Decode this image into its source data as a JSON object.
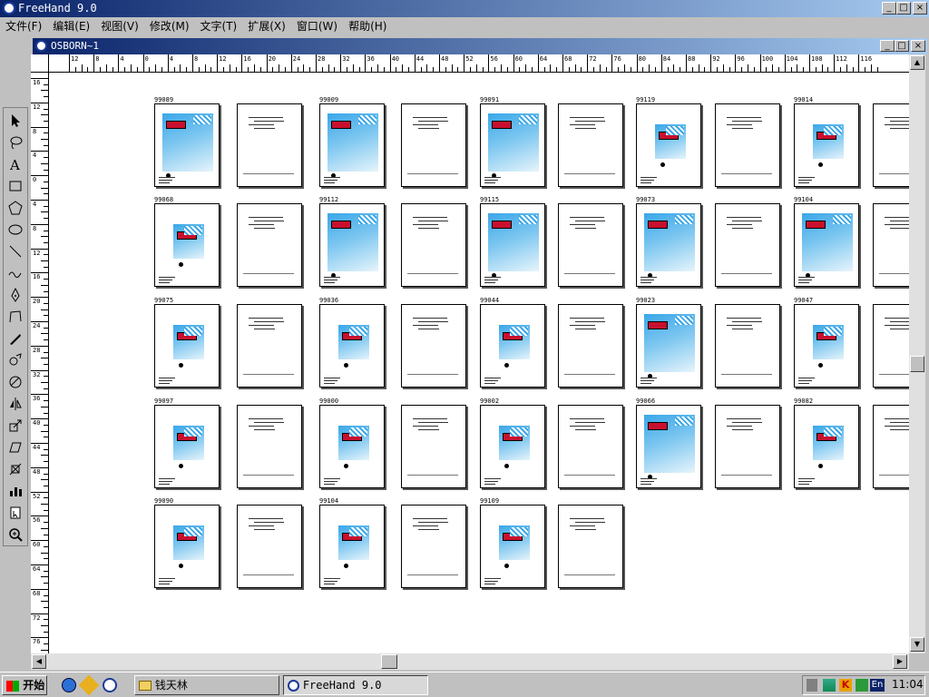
{
  "app": {
    "title": "FreeHand 9.0"
  },
  "menu": [
    "文件(F)",
    "编辑(E)",
    "视图(V)",
    "修改(M)",
    "文字(T)",
    "扩展(X)",
    "窗口(W)",
    "帮助(H)"
  ],
  "document": {
    "title": "OSBORN~1"
  },
  "ruler": {
    "h_labels": [
      "12",
      "8",
      "4",
      "0",
      "4",
      "8",
      "12",
      "16",
      "20",
      "24",
      "28",
      "32",
      "36",
      "40",
      "44",
      "48",
      "52",
      "56",
      "60",
      "64",
      "68",
      "72",
      "76",
      "80",
      "84",
      "88",
      "92",
      "96",
      "100",
      "104",
      "108",
      "112",
      "116"
    ],
    "v_labels": [
      "16",
      "12",
      "8",
      "4",
      "0",
      "4",
      "8",
      "12",
      "16",
      "20",
      "24",
      "28",
      "32",
      "36",
      "40",
      "44",
      "48",
      "52",
      "56",
      "60",
      "64",
      "68",
      "72",
      "76"
    ]
  },
  "tools": [
    {
      "name": "pointer-tool-icon"
    },
    {
      "name": "lasso-tool-icon"
    },
    {
      "name": "text-tool-icon"
    },
    {
      "name": "rectangle-tool-icon"
    },
    {
      "name": "polygon-tool-icon"
    },
    {
      "name": "ellipse-tool-icon"
    },
    {
      "name": "line-tool-icon"
    },
    {
      "name": "freehand-tool-icon"
    },
    {
      "name": "pen-tool-icon"
    },
    {
      "name": "bezigon-tool-icon"
    },
    {
      "name": "knife-tool-icon"
    },
    {
      "name": "trace-tool-icon"
    },
    {
      "name": "rotate-tool-icon"
    },
    {
      "name": "reflect-tool-icon"
    },
    {
      "name": "scale-tool-icon"
    },
    {
      "name": "skew-tool-icon"
    },
    {
      "name": "perspective-tool-icon"
    },
    {
      "name": "chart-tool-icon"
    },
    {
      "name": "page-tool-icon"
    },
    {
      "name": "zoom-tool-icon"
    }
  ],
  "pages": {
    "row_labels": [
      [
        "99089",
        "",
        "99009",
        "",
        "99091",
        "",
        "99119",
        "",
        "99014",
        ""
      ],
      [
        "99068",
        "",
        "99112",
        "",
        "99115",
        "",
        "99073",
        "",
        "99104",
        ""
      ],
      [
        "99075",
        "",
        "99036",
        "",
        "99044",
        "",
        "99023",
        "",
        "99047",
        ""
      ],
      [
        "99097",
        "",
        "99000",
        "",
        "99002",
        "",
        "99066",
        "",
        "99082",
        ""
      ],
      [
        "99090",
        "",
        "99104",
        "",
        "99109",
        ""
      ]
    ]
  },
  "taskbar": {
    "start_label": "开始",
    "folder_label": "钱天林",
    "app_label": "FreeHand 9.0",
    "clock": "11:04",
    "lang": "En"
  }
}
